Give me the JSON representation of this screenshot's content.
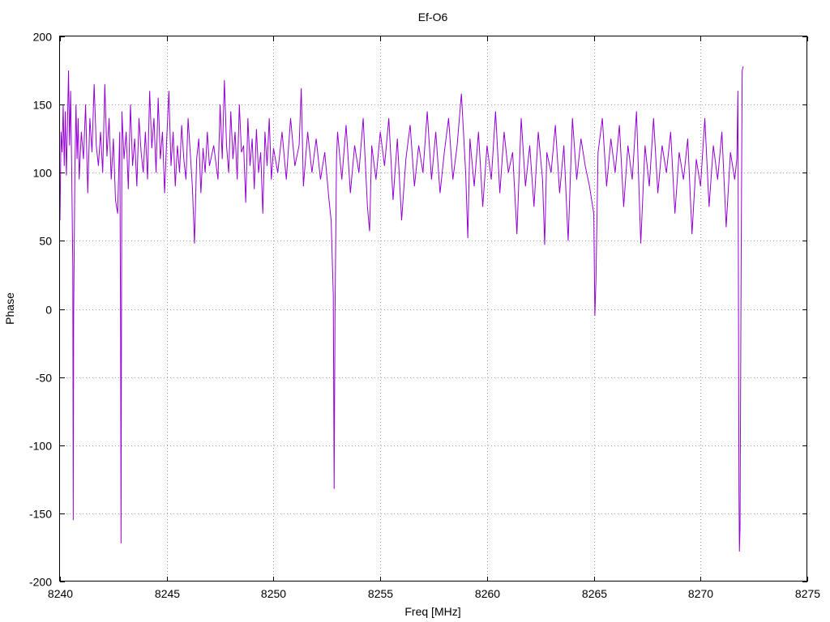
{
  "chart_data": {
    "type": "line",
    "title": "Ef-O6",
    "xlabel": "Freq [MHz]",
    "ylabel": "Phase",
    "xlim": [
      8240,
      8275
    ],
    "ylim": [
      -200,
      200
    ],
    "xticks": [
      8240,
      8245,
      8250,
      8255,
      8260,
      8265,
      8270,
      8275
    ],
    "xtick_labels": [
      "8240",
      "8245",
      "8250",
      "8255",
      "8260",
      "8265",
      "8270",
      "8275"
    ],
    "yticks": [
      -200,
      -150,
      -100,
      -50,
      0,
      50,
      100,
      150,
      200
    ],
    "ytick_labels": [
      "-200",
      "-150",
      "-100",
      "-50",
      "0",
      "50",
      "100",
      "150",
      "200"
    ],
    "grid": true,
    "series": [
      {
        "color": "#9400d3",
        "x_start": 8240,
        "x_end": 8272,
        "points": [
          [
            8240.0,
            65
          ],
          [
            8240.05,
            130
          ],
          [
            8240.1,
            115
          ],
          [
            8240.15,
            150
          ],
          [
            8240.2,
            105
          ],
          [
            8240.25,
            145
          ],
          [
            8240.3,
            98
          ],
          [
            8240.35,
            135
          ],
          [
            8240.4,
            175
          ],
          [
            8240.45,
            120
          ],
          [
            8240.5,
            160
          ],
          [
            8240.55,
            100
          ],
          [
            8240.6,
            30
          ],
          [
            8240.62,
            -155
          ],
          [
            8240.64,
            -5
          ],
          [
            8240.7,
            105
          ],
          [
            8240.75,
            150
          ],
          [
            8240.8,
            110
          ],
          [
            8240.85,
            140
          ],
          [
            8240.9,
            95
          ],
          [
            8241.0,
            130
          ],
          [
            8241.1,
            110
          ],
          [
            8241.2,
            150
          ],
          [
            8241.3,
            85
          ],
          [
            8241.4,
            140
          ],
          [
            8241.5,
            115
          ],
          [
            8241.6,
            165
          ],
          [
            8241.7,
            120
          ],
          [
            8241.8,
            105
          ],
          [
            8241.9,
            130
          ],
          [
            8242.0,
            100
          ],
          [
            8242.1,
            165
          ],
          [
            8242.2,
            112
          ],
          [
            8242.3,
            140
          ],
          [
            8242.4,
            95
          ],
          [
            8242.5,
            125
          ],
          [
            8242.6,
            80
          ],
          [
            8242.7,
            70
          ],
          [
            8242.8,
            130
          ],
          [
            8242.84,
            -20
          ],
          [
            8242.86,
            -172
          ],
          [
            8242.9,
            145
          ],
          [
            8243.0,
            110
          ],
          [
            8243.1,
            130
          ],
          [
            8243.2,
            88
          ],
          [
            8243.3,
            150
          ],
          [
            8243.4,
            105
          ],
          [
            8243.5,
            125
          ],
          [
            8243.6,
            90
          ],
          [
            8243.7,
            140
          ],
          [
            8243.8,
            115
          ],
          [
            8243.9,
            100
          ],
          [
            8244.0,
            130
          ],
          [
            8244.1,
            95
          ],
          [
            8244.2,
            160
          ],
          [
            8244.3,
            118
          ],
          [
            8244.4,
            140
          ],
          [
            8244.5,
            100
          ],
          [
            8244.6,
            155
          ],
          [
            8244.7,
            110
          ],
          [
            8244.8,
            130
          ],
          [
            8244.9,
            85
          ],
          [
            8245.0,
            125
          ],
          [
            8245.1,
            160
          ],
          [
            8245.2,
            105
          ],
          [
            8245.3,
            130
          ],
          [
            8245.4,
            90
          ],
          [
            8245.5,
            120
          ],
          [
            8245.6,
            100
          ],
          [
            8245.7,
            135
          ],
          [
            8245.8,
            110
          ],
          [
            8245.9,
            95
          ],
          [
            8246.0,
            140
          ],
          [
            8246.1,
            115
          ],
          [
            8246.2,
            90
          ],
          [
            8246.3,
            48
          ],
          [
            8246.4,
            110
          ],
          [
            8246.5,
            125
          ],
          [
            8246.6,
            85
          ],
          [
            8246.7,
            118
          ],
          [
            8246.8,
            100
          ],
          [
            8246.9,
            130
          ],
          [
            8247.0,
            105
          ],
          [
            8247.2,
            120
          ],
          [
            8247.4,
            95
          ],
          [
            8247.5,
            150
          ],
          [
            8247.6,
            110
          ],
          [
            8247.7,
            168
          ],
          [
            8247.8,
            120
          ],
          [
            8247.9,
            100
          ],
          [
            8248.0,
            145
          ],
          [
            8248.1,
            110
          ],
          [
            8248.2,
            130
          ],
          [
            8248.3,
            95
          ],
          [
            8248.4,
            150
          ],
          [
            8248.5,
            115
          ],
          [
            8248.6,
            120
          ],
          [
            8248.7,
            78
          ],
          [
            8248.8,
            140
          ],
          [
            8248.9,
            105
          ],
          [
            8249.0,
            125
          ],
          [
            8249.1,
            88
          ],
          [
            8249.2,
            132
          ],
          [
            8249.3,
            100
          ],
          [
            8249.4,
            115
          ],
          [
            8249.5,
            70
          ],
          [
            8249.6,
            130
          ],
          [
            8249.7,
            105
          ],
          [
            8249.8,
            140
          ],
          [
            8249.9,
            95
          ],
          [
            8250.0,
            118
          ],
          [
            8250.2,
            100
          ],
          [
            8250.4,
            130
          ],
          [
            8250.6,
            95
          ],
          [
            8250.8,
            140
          ],
          [
            8251.0,
            105
          ],
          [
            8251.2,
            120
          ],
          [
            8251.3,
            162
          ],
          [
            8251.4,
            90
          ],
          [
            8251.6,
            130
          ],
          [
            8251.8,
            100
          ],
          [
            8252.0,
            125
          ],
          [
            8252.2,
            95
          ],
          [
            8252.4,
            115
          ],
          [
            8252.6,
            80
          ],
          [
            8252.7,
            65
          ],
          [
            8252.8,
            10
          ],
          [
            8252.84,
            -132
          ],
          [
            8252.88,
            -5
          ],
          [
            8252.95,
            110
          ],
          [
            8253.0,
            130
          ],
          [
            8253.2,
            95
          ],
          [
            8253.4,
            135
          ],
          [
            8253.6,
            85
          ],
          [
            8253.8,
            120
          ],
          [
            8254.0,
            100
          ],
          [
            8254.2,
            140
          ],
          [
            8254.4,
            75
          ],
          [
            8254.5,
            57
          ],
          [
            8254.6,
            120
          ],
          [
            8254.8,
            95
          ],
          [
            8255.0,
            130
          ],
          [
            8255.2,
            105
          ],
          [
            8255.4,
            140
          ],
          [
            8255.6,
            80
          ],
          [
            8255.8,
            125
          ],
          [
            8256.0,
            65
          ],
          [
            8256.2,
            110
          ],
          [
            8256.4,
            135
          ],
          [
            8256.6,
            90
          ],
          [
            8256.8,
            120
          ],
          [
            8257.0,
            100
          ],
          [
            8257.2,
            145
          ],
          [
            8257.4,
            95
          ],
          [
            8257.6,
            130
          ],
          [
            8257.8,
            85
          ],
          [
            8258.0,
            115
          ],
          [
            8258.2,
            140
          ],
          [
            8258.4,
            95
          ],
          [
            8258.6,
            120
          ],
          [
            8258.8,
            158
          ],
          [
            8259.0,
            100
          ],
          [
            8259.1,
            52
          ],
          [
            8259.2,
            125
          ],
          [
            8259.4,
            90
          ],
          [
            8259.6,
            130
          ],
          [
            8259.8,
            75
          ],
          [
            8260.0,
            120
          ],
          [
            8260.2,
            95
          ],
          [
            8260.4,
            145
          ],
          [
            8260.6,
            85
          ],
          [
            8260.8,
            130
          ],
          [
            8261.0,
            100
          ],
          [
            8261.2,
            115
          ],
          [
            8261.4,
            55
          ],
          [
            8261.6,
            140
          ],
          [
            8261.8,
            90
          ],
          [
            8262.0,
            120
          ],
          [
            8262.2,
            75
          ],
          [
            8262.4,
            130
          ],
          [
            8262.6,
            95
          ],
          [
            8262.7,
            47
          ],
          [
            8262.8,
            115
          ],
          [
            8263.0,
            100
          ],
          [
            8263.2,
            135
          ],
          [
            8263.4,
            85
          ],
          [
            8263.6,
            120
          ],
          [
            8263.8,
            50
          ],
          [
            8264.0,
            140
          ],
          [
            8264.2,
            95
          ],
          [
            8264.4,
            125
          ],
          [
            8264.6,
            105
          ],
          [
            8264.8,
            90
          ],
          [
            8265.0,
            70
          ],
          [
            8265.05,
            -5
          ],
          [
            8265.1,
            20
          ],
          [
            8265.2,
            115
          ],
          [
            8265.4,
            140
          ],
          [
            8265.6,
            90
          ],
          [
            8265.8,
            125
          ],
          [
            8266.0,
            100
          ],
          [
            8266.2,
            135
          ],
          [
            8266.4,
            75
          ],
          [
            8266.6,
            120
          ],
          [
            8266.8,
            95
          ],
          [
            8267.0,
            145
          ],
          [
            8267.2,
            48
          ],
          [
            8267.4,
            120
          ],
          [
            8267.6,
            90
          ],
          [
            8267.8,
            140
          ],
          [
            8268.0,
            85
          ],
          [
            8268.2,
            120
          ],
          [
            8268.4,
            100
          ],
          [
            8268.6,
            130
          ],
          [
            8268.8,
            70
          ],
          [
            8269.0,
            115
          ],
          [
            8269.2,
            95
          ],
          [
            8269.4,
            125
          ],
          [
            8269.6,
            55
          ],
          [
            8269.8,
            110
          ],
          [
            8270.0,
            90
          ],
          [
            8270.2,
            140
          ],
          [
            8270.4,
            75
          ],
          [
            8270.6,
            120
          ],
          [
            8270.8,
            95
          ],
          [
            8271.0,
            130
          ],
          [
            8271.2,
            60
          ],
          [
            8271.4,
            115
          ],
          [
            8271.6,
            95
          ],
          [
            8271.7,
            110
          ],
          [
            8271.75,
            160
          ],
          [
            8271.8,
            -135
          ],
          [
            8271.82,
            -178
          ],
          [
            8271.85,
            -160
          ],
          [
            8271.9,
            30
          ],
          [
            8271.95,
            175
          ],
          [
            8272.0,
            178
          ]
        ]
      }
    ]
  }
}
